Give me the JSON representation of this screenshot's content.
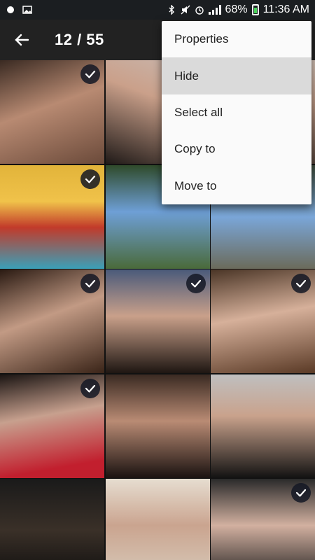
{
  "status_bar": {
    "battery": "68%",
    "time": "11:36 AM",
    "battery_level": 0.68,
    "icons": [
      "notification-dot-icon",
      "image-icon",
      "bluetooth-icon",
      "mute-icon",
      "alarm-icon",
      "signal-icon",
      "battery-icon"
    ]
  },
  "app_bar": {
    "counter": "12 / 55",
    "back_icon": "arrow-left-icon"
  },
  "menu": {
    "items": [
      {
        "label": "Properties"
      },
      {
        "label": "Hide",
        "highlighted": true
      },
      {
        "label": "Select all"
      },
      {
        "label": "Copy to"
      },
      {
        "label": "Move to"
      }
    ]
  },
  "grid": {
    "columns": 3,
    "photos": [
      {
        "selected": true
      },
      {
        "selected": false
      },
      {
        "selected": false
      },
      {
        "selected": true
      },
      {
        "selected": false
      },
      {
        "selected": false
      },
      {
        "selected": true
      },
      {
        "selected": true
      },
      {
        "selected": true
      },
      {
        "selected": true
      },
      {
        "selected": false
      },
      {
        "selected": false
      },
      {
        "selected": false
      },
      {
        "selected": false
      },
      {
        "selected": true
      }
    ]
  },
  "colors": {
    "status_bar_bg": "#1b1e21",
    "app_bar_bg": "#222222",
    "menu_bg": "#fafafa",
    "menu_highlight": "#dadada",
    "battery_green": "#49d35a",
    "check_bg": "#141824"
  }
}
